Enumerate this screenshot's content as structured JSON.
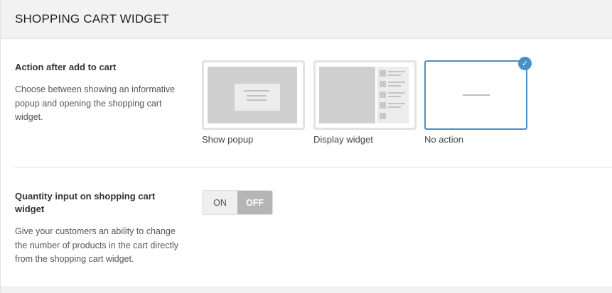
{
  "header": {
    "title": "SHOPPING CART WIDGET"
  },
  "action_setting": {
    "label": "Action after add to cart",
    "description": "Choose between showing an informative popup and opening the shopping cart widget.",
    "options": [
      {
        "label": "Show popup",
        "selected": false,
        "icon": "popup-preview"
      },
      {
        "label": "Display widget",
        "selected": false,
        "icon": "widget-preview"
      },
      {
        "label": "No action",
        "selected": true,
        "icon": "no-action-preview"
      }
    ],
    "selected_check_icon": "checkmark-icon"
  },
  "quantity_setting": {
    "label": "Quantity input on shopping cart widget",
    "description": "Give your customers an ability to change the number of products in the cart directly from the shopping cart widget.",
    "toggle": {
      "on_label": "ON",
      "off_label": "OFF",
      "value": "OFF"
    }
  },
  "colors": {
    "accent": "#4a90c8",
    "toggle_active": "#b5b5b5"
  }
}
